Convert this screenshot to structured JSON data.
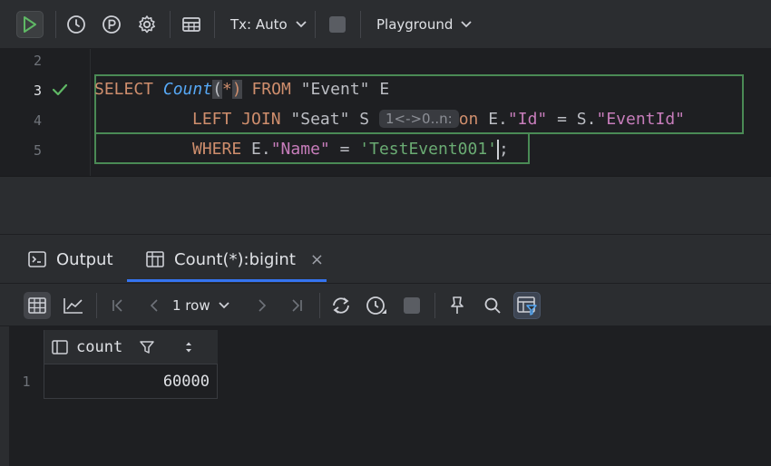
{
  "toolbar": {
    "icons": [
      "play-icon",
      "history-icon",
      "p-circle-icon",
      "gear-icon",
      "table-icon",
      "stop-icon",
      "chevron-down-icon"
    ],
    "tx_label": "Tx: Auto",
    "playground_label": "Playground"
  },
  "editor": {
    "line_numbers": [
      "2",
      "3",
      "4",
      "5"
    ],
    "lines": {
      "l3": {
        "select": "SELECT",
        "count": "Count",
        "paren_open": "(",
        "star": "*",
        "paren_close": ")",
        "from": "FROM",
        "table": "\"Event\"",
        "alias": "E"
      },
      "l4": {
        "left_join": "LEFT JOIN",
        "table": "\"Seat\"",
        "alias": "S",
        "hint": "1<->0..n:",
        "on": "on",
        "e_prefix": "E.",
        "id_col": "\"Id\"",
        "eq": "=",
        "s_prefix": "S.",
        "eventid_col": "\"EventId\""
      },
      "l5": {
        "where": "WHERE",
        "e_prefix": "E.",
        "name_col": "\"Name\"",
        "eq": "=",
        "value": "'TestEvent001'",
        "semicolon": ";"
      }
    }
  },
  "results": {
    "tabs": [
      {
        "label": "Output",
        "icon": "terminal-icon"
      },
      {
        "label": "Count(*):bigint",
        "icon": "table-icon",
        "close": "×"
      }
    ],
    "toolbar": {
      "rows_label": "1 row",
      "icons": [
        "table-view-icon",
        "chart-icon",
        "first-page-icon",
        "prev-page-icon",
        "next-page-icon",
        "last-page-icon",
        "refresh-icon",
        "clock-icon",
        "stop-icon",
        "pin-icon",
        "search-icon",
        "filter-view-icon"
      ]
    },
    "grid": {
      "columns": [
        {
          "name": "count",
          "icons": [
            "column-icon",
            "filter-icon",
            "sort-icon"
          ]
        }
      ],
      "rows": [
        {
          "num": "1",
          "count": "60000"
        }
      ]
    }
  },
  "colors": {
    "background": "#1e1f22",
    "panel": "#2b2d30",
    "keyword": "#cf8e6d",
    "function": "#56a8f5",
    "string": "#6aab73",
    "identifier": "#c77dbb",
    "accent": "#3574f0",
    "run_green": "#5fb865"
  }
}
